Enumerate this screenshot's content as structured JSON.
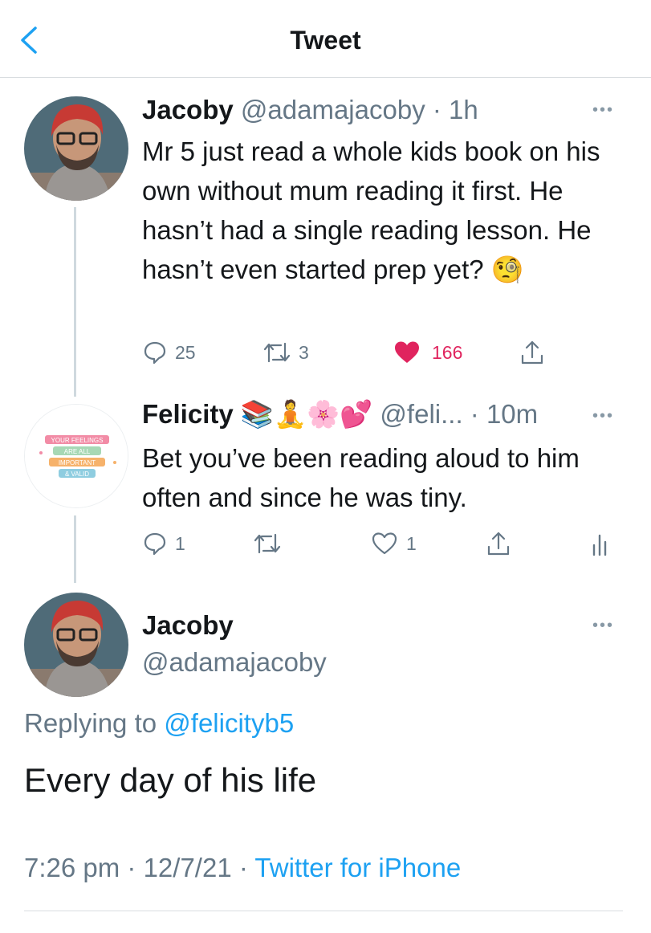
{
  "header": {
    "title": "Tweet"
  },
  "tweet1": {
    "name": "Jacoby",
    "handle": "@adamajacoby",
    "time": "· 1h",
    "text": "Mr 5 just read a whole kids book on his own without mum reading it first. He hasn’t had a single reading lesson. He hasn’t even started prep yet? 🧐",
    "replies": "25",
    "retweets": "3",
    "likes": "166",
    "colors": {
      "like": "#e0245e"
    }
  },
  "tweet2": {
    "name": "Felicity 📚🧘🌸💕",
    "handle": "@feli...",
    "time": "· 10m",
    "text": "Bet you’ve been reading aloud to him often and since he was tiny.",
    "replies": "1",
    "likes": "1",
    "avatar_text": [
      "YOUR FEELINGS",
      "ARE ALL",
      "IMPORTANT",
      "& VALID"
    ]
  },
  "main": {
    "name": "Jacoby",
    "handle": "@adamajacoby",
    "replying_prefix": "Replying to",
    "replying_to": "@felicityb5",
    "text": "Every day of his life",
    "time": "7:26 pm · 12/7/21 ·",
    "source": "Twitter for iPhone"
  },
  "colors": {
    "accent": "#1da1f2",
    "muted": "#657786"
  }
}
